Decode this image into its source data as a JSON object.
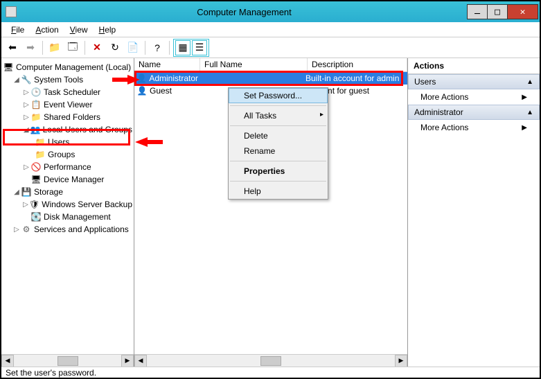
{
  "window": {
    "title": "Computer Management",
    "min": "Minimize",
    "max": "Maximize",
    "close": "Close"
  },
  "menu": {
    "file": "File",
    "action": "Action",
    "view": "View",
    "help": "Help"
  },
  "toolbar": {
    "back": "Back",
    "forward": "Forward",
    "up": "Up",
    "props": "Properties",
    "delete": "Delete",
    "refresh": "Refresh",
    "export": "Export",
    "help": "Help",
    "extra1": "Tile",
    "extra2": "List"
  },
  "tree": {
    "root": "Computer Management (Local)",
    "system_tools": "System Tools",
    "task_scheduler": "Task Scheduler",
    "event_viewer": "Event Viewer",
    "shared_folders": "Shared Folders",
    "local_users": "Local Users and Groups",
    "users": "Users",
    "groups": "Groups",
    "performance": "Performance",
    "device_manager": "Device Manager",
    "storage": "Storage",
    "ws_backup": "Windows Server Backup",
    "disk_mgmt": "Disk Management",
    "services_apps": "Services and Applications"
  },
  "list": {
    "col_name": "Name",
    "col_full": "Full Name",
    "col_desc": "Description",
    "rows": [
      {
        "name": "Administrator",
        "full": "",
        "desc": "Built-in account for admin"
      },
      {
        "name": "Guest",
        "full": "",
        "desc": "account for guest"
      }
    ]
  },
  "context_menu": {
    "set_password": "Set Password...",
    "all_tasks": "All Tasks",
    "delete": "Delete",
    "rename": "Rename",
    "properties": "Properties",
    "help": "Help"
  },
  "actions": {
    "header": "Actions",
    "sections": [
      {
        "title": "Users",
        "items": [
          "More Actions"
        ]
      },
      {
        "title": "Administrator",
        "items": [
          "More Actions"
        ]
      }
    ]
  },
  "status": "Set the user's password."
}
